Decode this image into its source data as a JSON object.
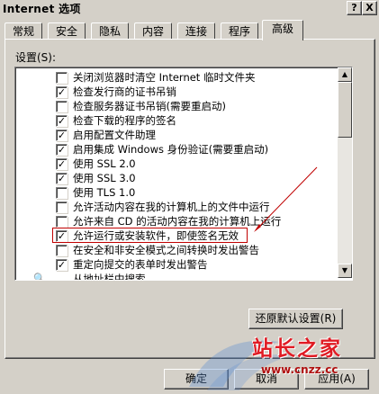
{
  "window": {
    "title": "Internet 选项",
    "help_glyph": "?",
    "close_glyph": "X"
  },
  "tabs": [
    {
      "label": "常规"
    },
    {
      "label": "安全"
    },
    {
      "label": "隐私"
    },
    {
      "label": "内容"
    },
    {
      "label": "连接"
    },
    {
      "label": "程序"
    },
    {
      "label": "高级",
      "active": true
    }
  ],
  "settings": {
    "label": "设置(S):",
    "items": [
      {
        "label": "关闭浏览器时清空 Internet 临时文件夹",
        "checked": false,
        "icon": "checkbox"
      },
      {
        "label": "检查发行商的证书吊销",
        "checked": true,
        "icon": "checkbox"
      },
      {
        "label": "检查服务器证书吊销(需要重启动)",
        "checked": false,
        "icon": "checkbox"
      },
      {
        "label": "检查下载的程序的签名",
        "checked": true,
        "icon": "checkbox"
      },
      {
        "label": "启用配置文件助理",
        "checked": true,
        "icon": "checkbox"
      },
      {
        "label": "启用集成 Windows 身份验证(需要重启动)",
        "checked": true,
        "icon": "checkbox"
      },
      {
        "label": "使用 SSL 2.0",
        "checked": true,
        "icon": "checkbox"
      },
      {
        "label": "使用 SSL 3.0",
        "checked": true,
        "icon": "checkbox"
      },
      {
        "label": "使用 TLS 1.0",
        "checked": false,
        "icon": "checkbox"
      },
      {
        "label": "允许活动内容在我的计算机上的文件中运行",
        "checked": false,
        "icon": "checkbox"
      },
      {
        "label": "允许来自 CD 的活动内容在我的计算机上运行",
        "checked": false,
        "icon": "checkbox"
      },
      {
        "label": "允许运行或安装软件，即使签名无效",
        "checked": true,
        "icon": "checkbox",
        "highlighted": true
      },
      {
        "label": "在安全和非安全模式之间转换时发出警告",
        "checked": false,
        "icon": "checkbox"
      },
      {
        "label": "重定向提交的表单时发出警告",
        "checked": true,
        "icon": "checkbox"
      },
      {
        "label": "从地址栏中搜索",
        "checked": false,
        "icon": "search-icon"
      }
    ]
  },
  "buttons": {
    "restore_defaults": "还原默认设置(R)",
    "ok": "确定",
    "cancel": "取消",
    "apply": "应用(A)"
  },
  "watermark": {
    "title": "站长之家",
    "url": "www.cnzz.cc"
  },
  "colors": {
    "dialog_bg": "#d4d0c8",
    "annotation": "#c00000",
    "watermark": "#e01b24"
  }
}
